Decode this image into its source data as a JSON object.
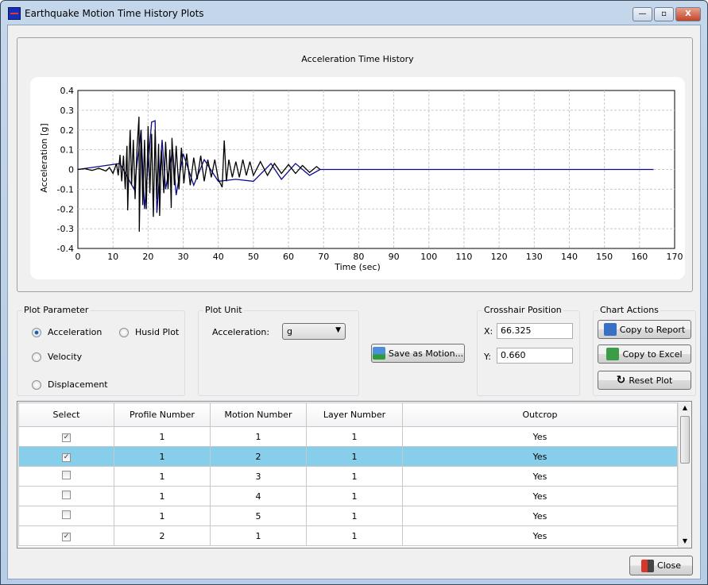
{
  "window": {
    "title": "Earthquake Motion Time History Plots",
    "minimize": "—",
    "maximize": "▫",
    "close": "X"
  },
  "chart_data": {
    "type": "line",
    "title": "Acceleration Time History",
    "xlabel": "Time (sec)",
    "ylabel": "Acceleration [g]",
    "xlim": [
      0,
      170
    ],
    "ylim": [
      -0.4,
      0.4
    ],
    "xticks": [
      0,
      10,
      20,
      30,
      40,
      50,
      60,
      70,
      80,
      90,
      100,
      110,
      120,
      130,
      140,
      150,
      160,
      170
    ],
    "yticks": [
      0.4,
      0.3,
      0.2,
      0.1,
      0,
      -0.1,
      -0.2,
      -0.3,
      -0.4
    ],
    "grid": true,
    "series": [
      {
        "color": "#0a0a8c",
        "x": [
          0,
          12,
          16,
          18,
          19,
          21,
          22,
          22.5,
          24,
          25,
          27,
          28,
          30,
          33,
          36,
          40,
          45,
          50,
          55,
          58,
          62,
          66,
          69,
          164
        ],
        "y": [
          0,
          0.03,
          -0.1,
          0.2,
          -0.2,
          0.24,
          0.247,
          -0.22,
          0.15,
          -0.1,
          0.1,
          -0.13,
          0.08,
          -0.08,
          0.05,
          -0.06,
          -0.05,
          -0.06,
          0.03,
          -0.05,
          0.03,
          -0.03,
          0,
          0
        ]
      },
      {
        "color": "#000000",
        "x": [
          0,
          2,
          4,
          6,
          8,
          9,
          10,
          11,
          11.5,
          12,
          12.5,
          13,
          13.5,
          14,
          14.2,
          14.6,
          14.9,
          15.3,
          15.8,
          16.3,
          16.8,
          17.4,
          17.5,
          18,
          18.5,
          19,
          19.5,
          20,
          20.5,
          21,
          21.5,
          22,
          22.5,
          23,
          23.3,
          23.8,
          24.5,
          25,
          25.7,
          26.2,
          26.6,
          26.8,
          27.5,
          28,
          28.8,
          29.5,
          30.2,
          31,
          32,
          33,
          34,
          35,
          36,
          37,
          38,
          39,
          40,
          41.1,
          41.7,
          42.3,
          43,
          44,
          45,
          46,
          47,
          48,
          49,
          50,
          52,
          54,
          56,
          58,
          60,
          62,
          64,
          66,
          68,
          69
        ],
        "y": [
          0,
          0.004,
          -0.005,
          0.006,
          -0.008,
          0.01,
          -0.02,
          0.03,
          -0.03,
          0.074,
          -0.06,
          0.07,
          -0.1,
          0.12,
          -0.207,
          0.05,
          0.2,
          -0.08,
          0.15,
          -0.15,
          0.09,
          0.267,
          -0.315,
          0.2,
          -0.18,
          0.15,
          -0.2,
          0.22,
          -0.12,
          0.18,
          -0.24,
          0.2,
          -0.15,
          0.13,
          -0.235,
          0.1,
          -0.12,
          0.14,
          -0.1,
          0.1,
          -0.195,
          0.16,
          -0.08,
          0.12,
          -0.1,
          0.11,
          -0.07,
          0.08,
          -0.08,
          0.06,
          -0.05,
          0.07,
          -0.06,
          0.05,
          -0.04,
          0.05,
          -0.05,
          -0.09,
          0.147,
          -0.06,
          0.05,
          -0.04,
          0.04,
          -0.04,
          0.05,
          -0.03,
          0.04,
          -0.03,
          0.04,
          -0.03,
          0.03,
          -0.02,
          0.025,
          -0.02,
          0.02,
          -0.015,
          0.015,
          0
        ]
      }
    ]
  },
  "plot_parameter": {
    "label": "Plot Parameter",
    "options": [
      "Acceleration",
      "Husid Plot",
      "Velocity",
      "Displacement"
    ],
    "selected": "Acceleration"
  },
  "plot_unit": {
    "label": "Plot Unit",
    "field_label": "Acceleration:",
    "value": "g"
  },
  "save_motion": "Save as Motion...",
  "crosshair": {
    "label": "Crosshair Position",
    "x_label": "X:",
    "x_value": "66.325",
    "y_label": "Y:",
    "y_value": "0.660"
  },
  "chart_actions": {
    "label": "Chart Actions",
    "copy_report": "Copy to Report",
    "copy_excel": "Copy to Excel",
    "reset": "Reset Plot"
  },
  "table": {
    "columns": [
      "Select",
      "Profile Number",
      "Motion Number",
      "Layer Number",
      "Outcrop"
    ],
    "rows": [
      {
        "select": true,
        "profile": "1",
        "motion": "1",
        "layer": "1",
        "outcrop": "Yes"
      },
      {
        "select": true,
        "profile": "1",
        "motion": "2",
        "layer": "1",
        "outcrop": "Yes",
        "selected_row": true
      },
      {
        "select": false,
        "profile": "1",
        "motion": "3",
        "layer": "1",
        "outcrop": "Yes"
      },
      {
        "select": false,
        "profile": "1",
        "motion": "4",
        "layer": "1",
        "outcrop": "Yes"
      },
      {
        "select": false,
        "profile": "1",
        "motion": "5",
        "layer": "1",
        "outcrop": "Yes"
      },
      {
        "select": true,
        "profile": "2",
        "motion": "1",
        "layer": "1",
        "outcrop": "Yes"
      }
    ]
  },
  "close": "Close"
}
